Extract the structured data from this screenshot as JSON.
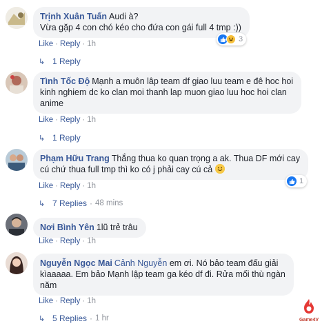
{
  "colors": {
    "link": "#385898",
    "bubble": "#f2f3f5",
    "meta": "#90949c",
    "like": "#1877f2"
  },
  "action_labels": {
    "like": "Like",
    "reply": "Reply",
    "separator": "·"
  },
  "comments": [
    {
      "author": "Trịnh Xuân Tuấn",
      "lines": [
        "Audi à?",
        "Vừa gặp 4 con chó kéo cho đứa con gái full 4 tmp :))"
      ],
      "time": "1h",
      "reactions": {
        "icons": [
          "like-icon",
          "haha-icon"
        ],
        "count": "3"
      },
      "replies": {
        "label": "1 Reply",
        "time": ""
      }
    },
    {
      "author": "Tình Tốc Độ",
      "lines": [
        "Mạnh a muôn lâp team df giao luu team e đê hoc hoi",
        "kinh nghiem dc ko clan moi thanh lap muon giao luu hoc hoi clan",
        "anime"
      ],
      "time": "1h",
      "reactions": null,
      "replies": {
        "label": "1 Reply",
        "time": ""
      }
    },
    {
      "author": "Phạm Hữu Trang",
      "lines": [
        "Thắng thua ko quan trọng a ak. Thua DF mới cay",
        "cú chứ thua full tmp thì ko có j phải cay cú cả"
      ],
      "time": "1h",
      "reactions": {
        "icons": [
          "like-icon"
        ],
        "count": "1"
      },
      "replies": {
        "label": "7 Replies",
        "time": "48 mins"
      }
    },
    {
      "author": "Nơi Bình Yên",
      "lines": [
        "1lũ trẻ trâu"
      ],
      "time": "1h",
      "reactions": null,
      "replies": null
    },
    {
      "author": "Nguyễn Ngọc Mai",
      "mention": "Cảnh Nguyễn",
      "lines": [
        "em ơi. Nó bảo team đấu giải",
        "kìaaaaa. Em bảo Mạnh lập team ga kéo df đi. Rửa mối thù ngàn",
        "năm"
      ],
      "time": "1h",
      "reactions": null,
      "replies": {
        "label": "5 Replies",
        "time": "1 hr"
      }
    }
  ],
  "watermark": {
    "text": "Game4V"
  }
}
